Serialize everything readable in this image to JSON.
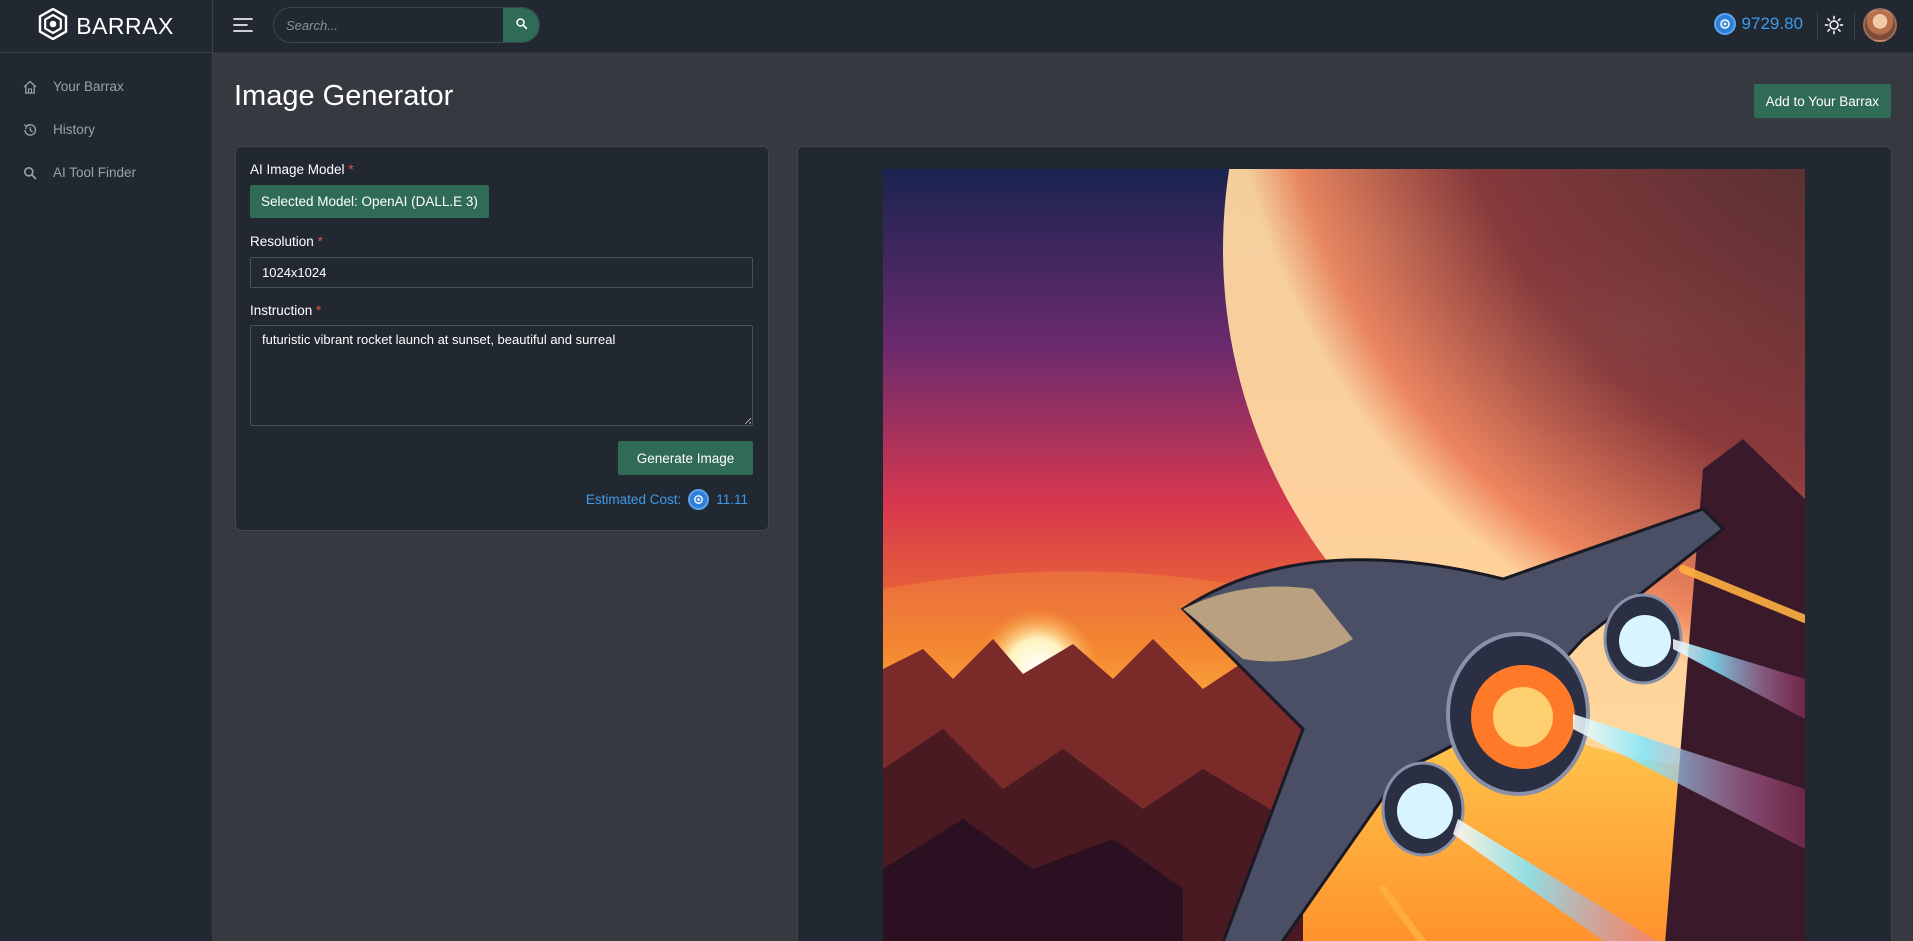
{
  "brand": {
    "name": "BARRAX",
    "logo_icon": "hexagon-logo-icon"
  },
  "sidebar": {
    "items": [
      {
        "label": "Your Barrax",
        "icon": "home-icon"
      },
      {
        "label": "History",
        "icon": "history-icon"
      },
      {
        "label": "AI Tool Finder",
        "icon": "search-icon"
      }
    ]
  },
  "header": {
    "search_placeholder": "Search...",
    "balance": "9729.80"
  },
  "main": {
    "title": "Image Generator",
    "add_button_label": "Add to Your Barrax",
    "form": {
      "model_label": "AI Image Model",
      "model_button_label": "Selected Model: OpenAI (DALL.E 3)",
      "resolution_label": "Resolution",
      "resolution_value": "1024x1024",
      "instruction_label": "Instruction",
      "instruction_value": "futuristic vibrant rocket launch at sunset, beautiful and surreal",
      "required_mark": "*",
      "generate_button_label": "Generate Image",
      "cost_label": "Estimated Cost:",
      "cost_value": "11.11"
    }
  },
  "colors": {
    "accent_green": "#2f6b55",
    "accent_blue": "#3d9be9",
    "required_red": "#e0524a",
    "sidebar_bg": "#222831",
    "page_bg": "#363a40"
  }
}
